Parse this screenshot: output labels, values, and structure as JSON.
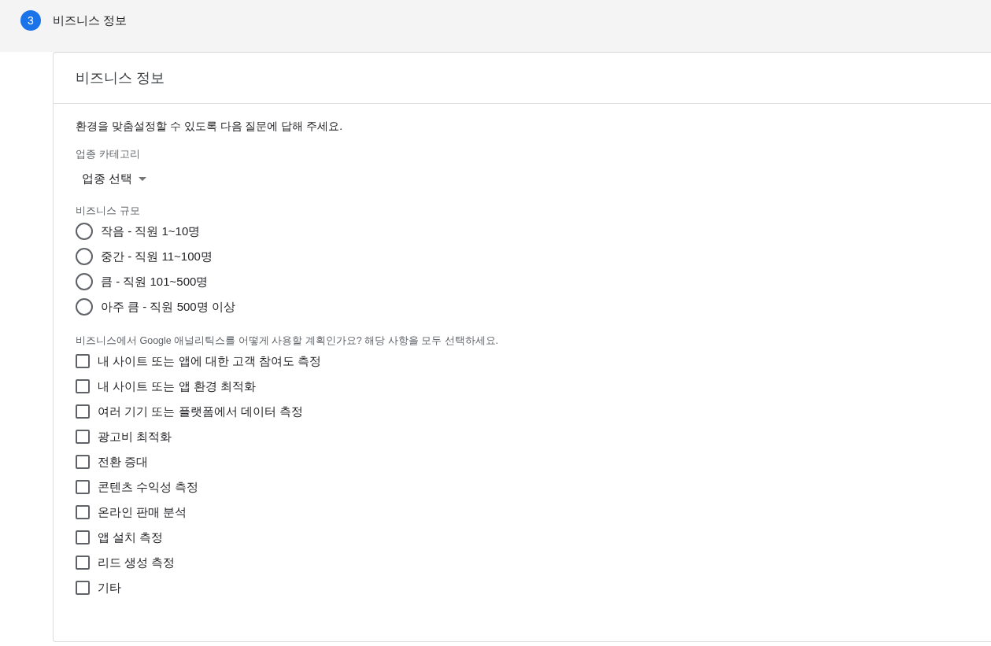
{
  "step": {
    "number": "3",
    "title": "비즈니스 정보"
  },
  "card": {
    "title": "비즈니스 정보",
    "intro": "환경을 맞춤설정할 수 있도록 다음 질문에 답해 주세요.",
    "category": {
      "label": "업종 카테고리",
      "value": "업종 선택"
    },
    "size": {
      "label": "비즈니스 규모",
      "options": [
        {
          "label": "작음 - 직원 1~10명",
          "selected": false
        },
        {
          "label": "중간 - 직원 11~100명",
          "selected": false
        },
        {
          "label": "큼 - 직원 101~500명",
          "selected": false
        },
        {
          "label": "아주 큼 - 직원 500명 이상",
          "selected": false
        }
      ]
    },
    "usage": {
      "label": "비즈니스에서 Google 애널리틱스를 어떻게 사용할 계획인가요? 해당 사항을 모두 선택하세요.",
      "options": [
        {
          "label": "내 사이트 또는 앱에 대한 고객 참여도 측정",
          "checked": false
        },
        {
          "label": "내 사이트 또는 앱 환경 최적화",
          "checked": false
        },
        {
          "label": "여러 기기 또는 플랫폼에서 데이터 측정",
          "checked": false
        },
        {
          "label": "광고비 최적화",
          "checked": false
        },
        {
          "label": "전환 증대",
          "checked": false
        },
        {
          "label": "콘텐츠 수익성 측정",
          "checked": false
        },
        {
          "label": "온라인 판매 분석",
          "checked": false
        },
        {
          "label": "앱 설치 측정",
          "checked": false
        },
        {
          "label": "리드 생성 측정",
          "checked": false
        },
        {
          "label": "기타",
          "checked": false
        }
      ]
    }
  }
}
